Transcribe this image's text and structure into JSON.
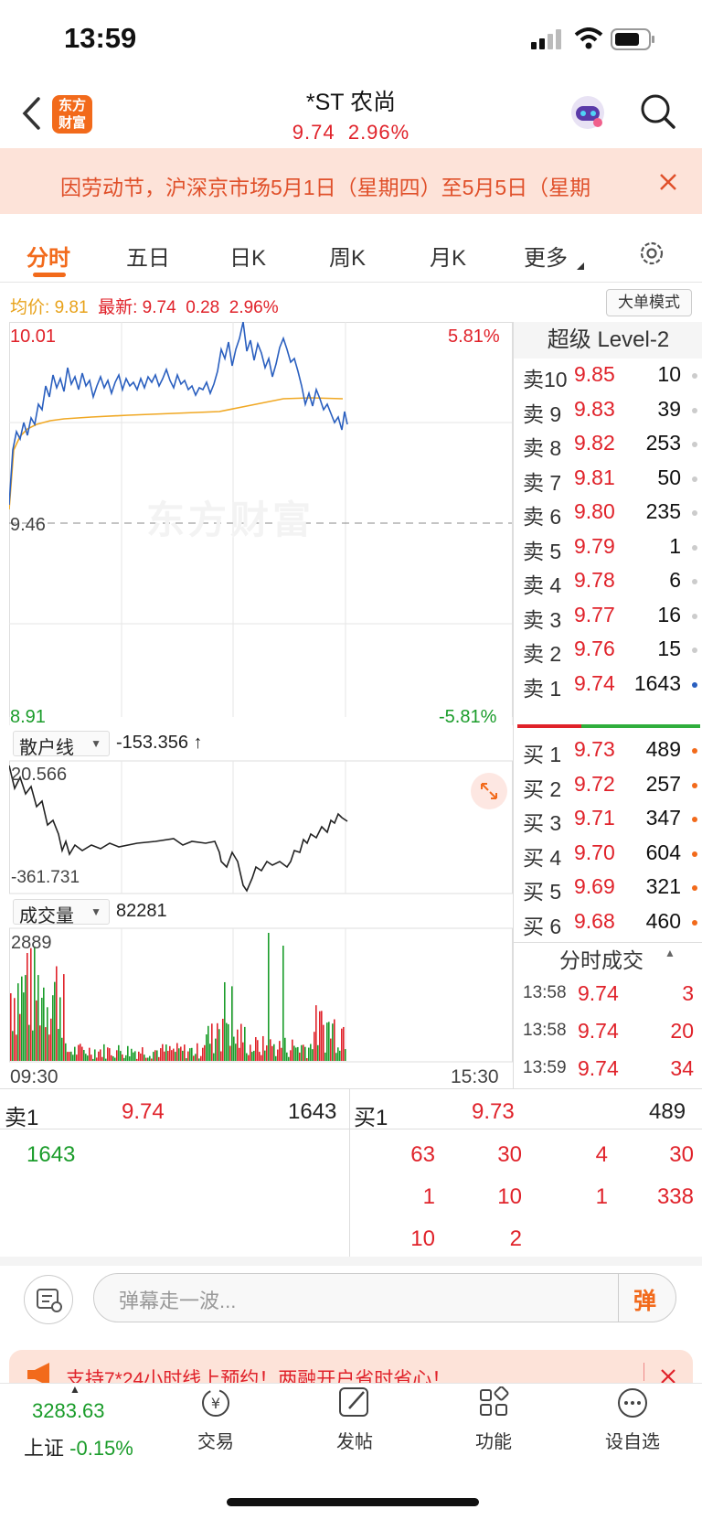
{
  "status_bar": {
    "time": "13:59"
  },
  "header": {
    "title": "*ST 农尚",
    "price": "9.74",
    "change_pct": "2.96%",
    "logo_line1": "东方",
    "logo_line2": "财富"
  },
  "notice": {
    "text": "因劳动节，沪深京市场5月1日（星期四）至5月5日（星期"
  },
  "tabs": [
    "分时",
    "五日",
    "日K",
    "周K",
    "月K",
    "更多"
  ],
  "info": {
    "avg_label": "均价:",
    "avg": "9.81",
    "latest_label": "最新:",
    "latest": "9.74",
    "change": "0.28",
    "change_pct": "2.96%",
    "big_mode": "大单模式"
  },
  "price_chart": {
    "high": "10.01",
    "high_pct": "5.81%",
    "base": "9.46",
    "low": "8.91",
    "low_pct": "-5.81%",
    "watermark": "东方财富"
  },
  "retail_line": {
    "label": "散户线",
    "value": "-153.356 ↑",
    "max": "20.566",
    "min": "-361.731"
  },
  "volume": {
    "label": "成交量",
    "value": "82281",
    "max": "2889",
    "start_time": "09:30",
    "end_time": "15:30"
  },
  "level2": {
    "title": "超级 Level-2",
    "asks": [
      {
        "label": "卖10",
        "price": "9.85",
        "qty": "10"
      },
      {
        "label": "卖 9",
        "price": "9.83",
        "qty": "39"
      },
      {
        "label": "卖 8",
        "price": "9.82",
        "qty": "253"
      },
      {
        "label": "卖 7",
        "price": "9.81",
        "qty": "50"
      },
      {
        "label": "卖 6",
        "price": "9.80",
        "qty": "235"
      },
      {
        "label": "卖 5",
        "price": "9.79",
        "qty": "1"
      },
      {
        "label": "卖 4",
        "price": "9.78",
        "qty": "6"
      },
      {
        "label": "卖 3",
        "price": "9.77",
        "qty": "16"
      },
      {
        "label": "卖 2",
        "price": "9.76",
        "qty": "15"
      },
      {
        "label": "卖 1",
        "price": "9.74",
        "qty": "1643"
      }
    ],
    "bids": [
      {
        "label": "买 1",
        "price": "9.73",
        "qty": "489"
      },
      {
        "label": "买 2",
        "price": "9.72",
        "qty": "257"
      },
      {
        "label": "买 3",
        "price": "9.71",
        "qty": "347"
      },
      {
        "label": "买 4",
        "price": "9.70",
        "qty": "604"
      },
      {
        "label": "买 5",
        "price": "9.69",
        "qty": "321"
      },
      {
        "label": "买 6",
        "price": "9.68",
        "qty": "460"
      }
    ],
    "trades_title": "分时成交",
    "trades": [
      {
        "time": "13:58",
        "price": "9.74",
        "qty": "3"
      },
      {
        "time": "13:58",
        "price": "9.74",
        "qty": "20"
      },
      {
        "time": "13:59",
        "price": "9.74",
        "qty": "34"
      }
    ]
  },
  "queue": {
    "sell_label": "卖1",
    "sell_price": "9.74",
    "sell_qty": "1643",
    "buy_label": "买1",
    "buy_price": "9.73",
    "buy_qty": "489",
    "sell_orders": [
      "1643"
    ],
    "buy_orders": [
      "63",
      "30",
      "4",
      "30",
      "1",
      "10",
      "1",
      "338",
      "10",
      "2"
    ]
  },
  "danmaku": {
    "placeholder": "弹幕走一波...",
    "button": "弹"
  },
  "promo": {
    "text": "支持7*24小时线上预约！两融开户省时省心！"
  },
  "tabbar": {
    "index_value": "3283.63",
    "index_name": "上证",
    "index_change": "-0.15%",
    "items": [
      "交易",
      "发帖",
      "功能",
      "设自选"
    ]
  }
}
